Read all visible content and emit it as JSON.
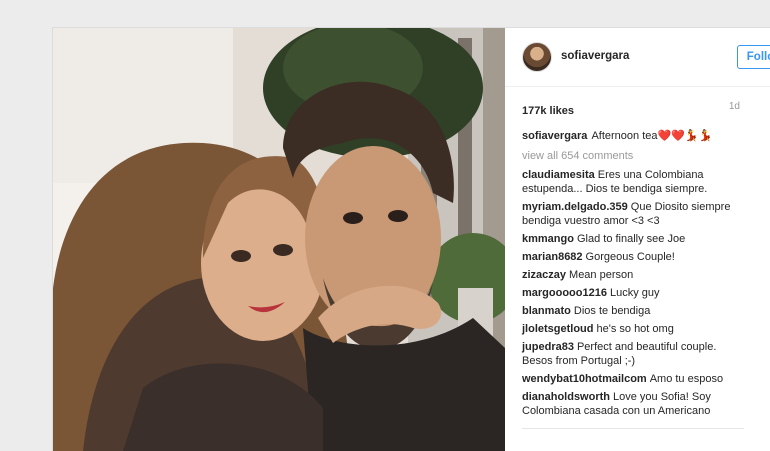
{
  "header": {
    "username": "sofiavergara",
    "follow_label": "Follow"
  },
  "stats": {
    "likes": "177k likes",
    "age": "1d"
  },
  "caption": {
    "username": "sofiavergara",
    "text": "Afternoon tea❤️❤️💃💃"
  },
  "view_all": "view all 654 comments",
  "comments": [
    {
      "user": "claudiamesita",
      "text": "Eres una Colombiana estupenda... Dios te bendiga siempre."
    },
    {
      "user": "myriam.delgado.359",
      "text": "Que Diosito siempre bendiga vuestro amor <3 <3"
    },
    {
      "user": "kmmango",
      "text": "Glad to finally see Joe"
    },
    {
      "user": "marian8682",
      "text": "Gorgeous Couple!"
    },
    {
      "user": "zizaczay",
      "text": "Mean person"
    },
    {
      "user": "margooooo1216",
      "text": "Lucky guy"
    },
    {
      "user": "blanmato",
      "text": "Dios te bendiga"
    },
    {
      "user": "jloletsgetloud",
      "text": "he's so hot omg"
    },
    {
      "user": "jupedra83",
      "text": "Perfect and beautiful couple. Besos from Portugal ;-)"
    },
    {
      "user": "wendybat10hotmailcom",
      "text": "Amo tu esposo"
    },
    {
      "user": "dianaholdsworth",
      "text": "Love you Sofia! Soy Colombiana casada con un Americano"
    }
  ],
  "colors": {
    "accent": "#3897f0",
    "text": "#262626",
    "muted": "#999999"
  }
}
